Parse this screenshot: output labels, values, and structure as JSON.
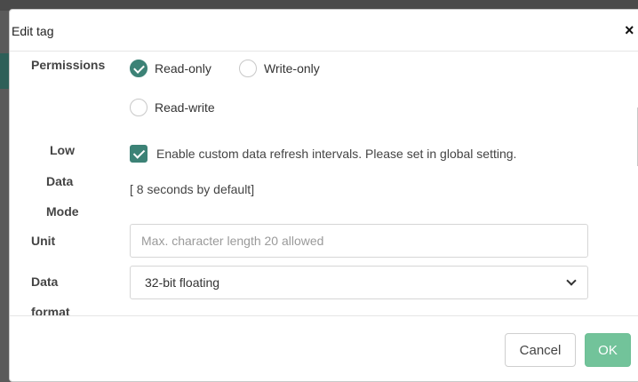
{
  "dialog": {
    "title": "Edit tag",
    "close_glyph": "×"
  },
  "permissions": {
    "label": "Permissions",
    "options": [
      {
        "label": "Read-only",
        "checked": true
      },
      {
        "label": "Write-only",
        "checked": false
      },
      {
        "label": "Read-write",
        "checked": false
      }
    ]
  },
  "low_data_mode": {
    "label_lines": [
      "Low",
      "Data",
      "Mode"
    ],
    "checkbox_label": "Enable custom data refresh intervals. Please set in global setting.",
    "checked": true,
    "note": "[ 8 seconds by default]"
  },
  "unit": {
    "label": "Unit",
    "value": "",
    "placeholder": "Max. character length 20 allowed"
  },
  "data_format": {
    "label_lines": [
      "Data",
      "format"
    ],
    "selected": "32-bit floating"
  },
  "footer": {
    "cancel_label": "Cancel",
    "ok_label": "OK"
  },
  "colors": {
    "accent": "#3c8276",
    "ok_button": "#72c39a"
  }
}
